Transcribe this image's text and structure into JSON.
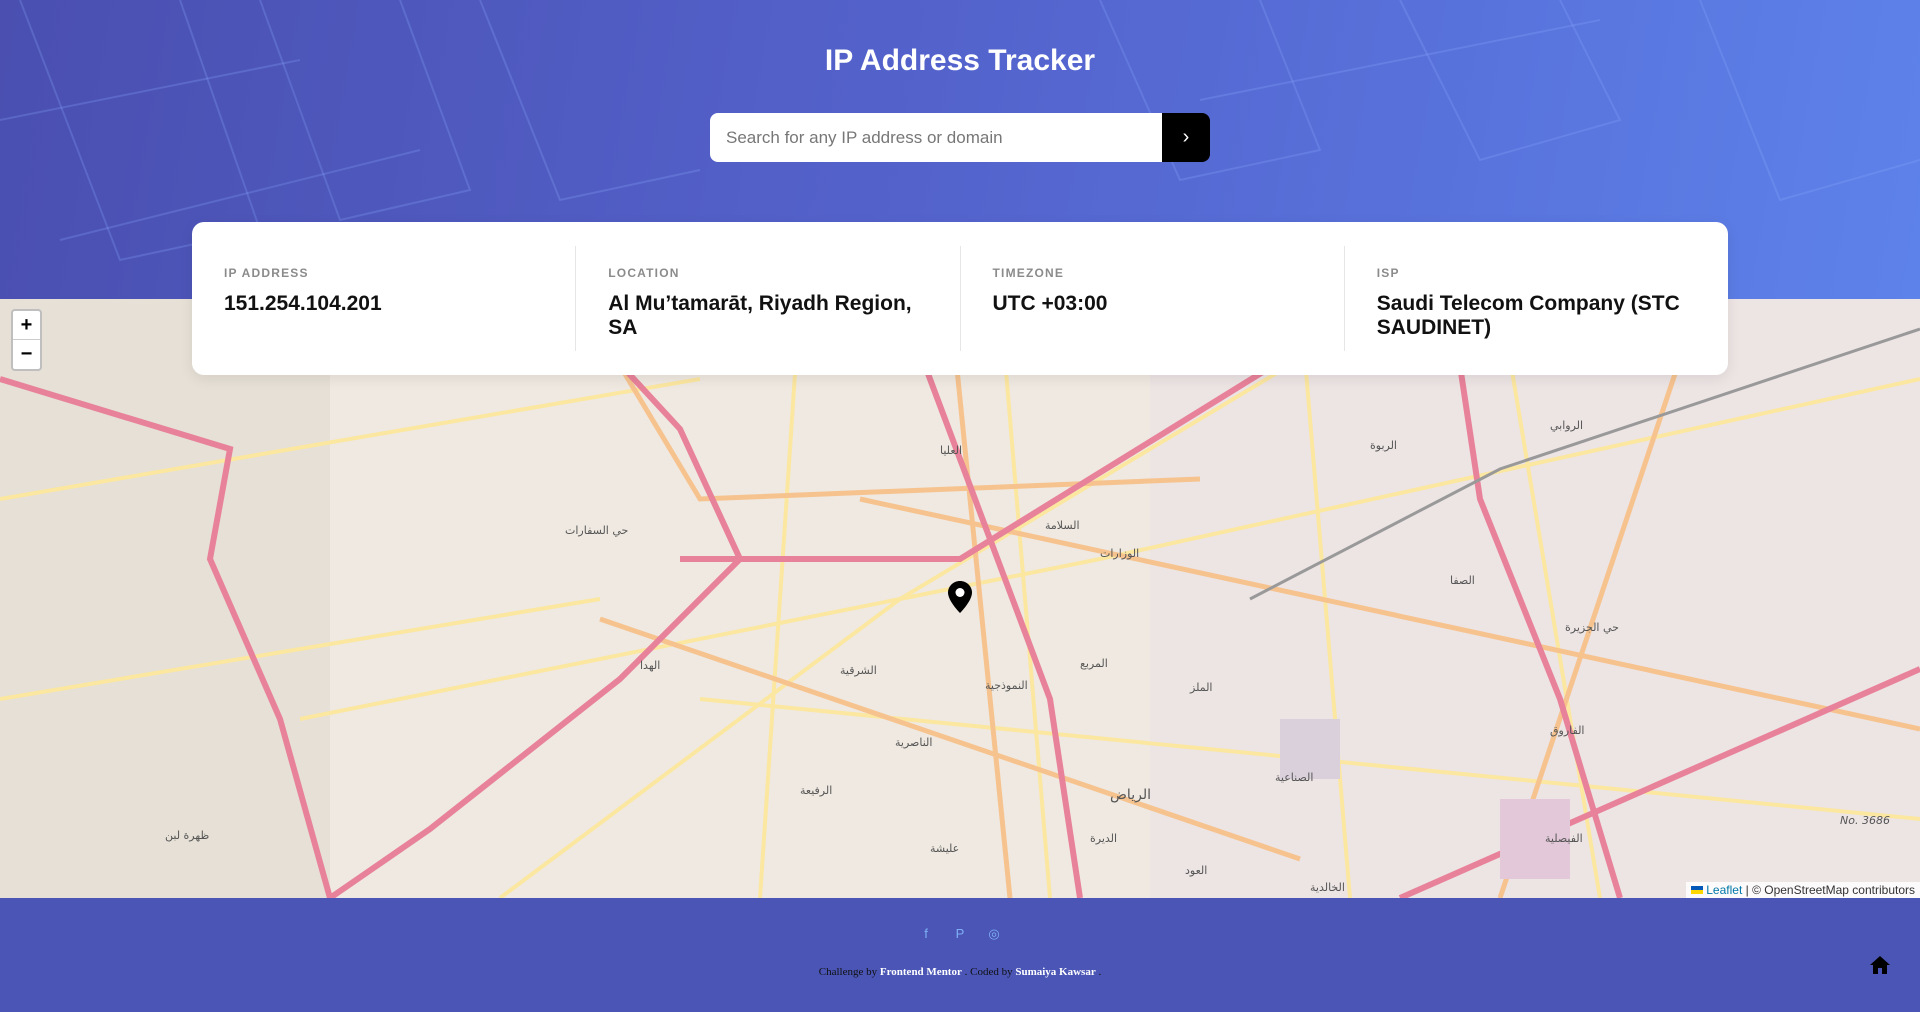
{
  "header": {
    "title": "IP Address Tracker",
    "search_placeholder": "Search for any IP address or domain",
    "submit_icon": "chevron-right-icon"
  },
  "info": [
    {
      "label": "IP ADDRESS",
      "value": "151.254.104.201"
    },
    {
      "label": "LOCATION",
      "value": "Al Mu’tamarāt, Riyadh Region, SA"
    },
    {
      "label": "TIMEZONE",
      "value": "UTC +03:00"
    },
    {
      "label": "ISP",
      "value": "Saudi Telecom Company (STC SAUDINET)"
    }
  ],
  "map": {
    "zoom_in": "+",
    "zoom_out": "−",
    "attribution_leaflet": "Leaflet",
    "attribution_rest": "| © OpenStreetMap contributors",
    "marker_icon": "map-pin-icon",
    "place_labels": [
      "حي السفارات",
      "العليا",
      "الهدا",
      "الشرقية",
      "النموذجية",
      "الرياض",
      "الملز",
      "الصفا",
      "الفاروق",
      "الصناعية",
      "الفيصلية",
      "حي الجزيرة",
      "الروابي",
      "الربوة",
      "السلامة",
      "الوزارات",
      "المربع",
      "الناصرية",
      "الرفيعة",
      "عليشة",
      "الديرة",
      "العود",
      "الخالدية",
      "ظهرة لبن",
      "No. 3686"
    ]
  },
  "footer": {
    "social": [
      "facebook-icon",
      "pinterest-icon",
      "instagram-icon"
    ],
    "challenge_by": "Challenge by",
    "frontend_mentor": "Frontend Mentor",
    "coded_by": ". Coded by",
    "author": "Sumaiya Kawsar",
    "end": "."
  }
}
